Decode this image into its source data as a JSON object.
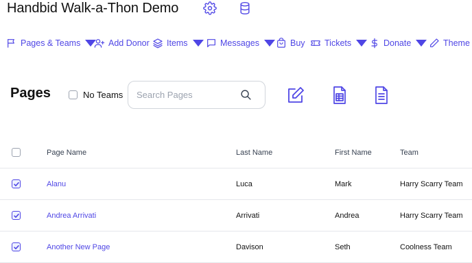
{
  "header": {
    "title": "Handbid Walk-a-Thon Demo",
    "icons": [
      "gear-icon",
      "database-icon"
    ]
  },
  "nav": {
    "items": [
      {
        "label": "Pages & Teams",
        "icon": "flag-icon",
        "dropdown": true
      },
      {
        "label": "Add Donor",
        "icon": "user-plus-icon",
        "dropdown": false
      },
      {
        "label": "Items",
        "icon": "layers-icon",
        "dropdown": true
      },
      {
        "label": "Messages",
        "icon": "message-icon",
        "dropdown": true
      },
      {
        "label": "Buy",
        "icon": "shopping-bag-icon",
        "dropdown": false
      },
      {
        "label": "Tickets",
        "icon": "ticket-icon",
        "dropdown": true
      },
      {
        "label": "Donate",
        "icon": "dollar-icon",
        "dropdown": true
      },
      {
        "label": "Theme",
        "icon": "pen-icon",
        "dropdown": false
      }
    ]
  },
  "section": {
    "title": "Pages",
    "no_teams_label": "No Teams",
    "no_teams_checked": false,
    "search_placeholder": "Search Pages",
    "search_value": "",
    "tools": [
      "edit-icon",
      "spreadsheet-icon",
      "document-icon"
    ]
  },
  "table": {
    "columns": [
      "Page Name",
      "Last Name",
      "First Name",
      "Team"
    ],
    "rows": [
      {
        "checked": true,
        "page_name": "Alanu",
        "last_name": "Luca",
        "first_name": "Mark",
        "team": "Harry Scarry Team"
      },
      {
        "checked": true,
        "page_name": "Andrea Arrivati",
        "last_name": "Arrivati",
        "first_name": "Andrea",
        "team": "Harry Scarry Team"
      },
      {
        "checked": true,
        "page_name": "Another New Page",
        "last_name": "Davison",
        "first_name": "Seth",
        "team": "Coolness Team"
      }
    ]
  },
  "colors": {
    "accent": "#4f46e5",
    "text": "#111111",
    "border": "#e5e7eb"
  }
}
